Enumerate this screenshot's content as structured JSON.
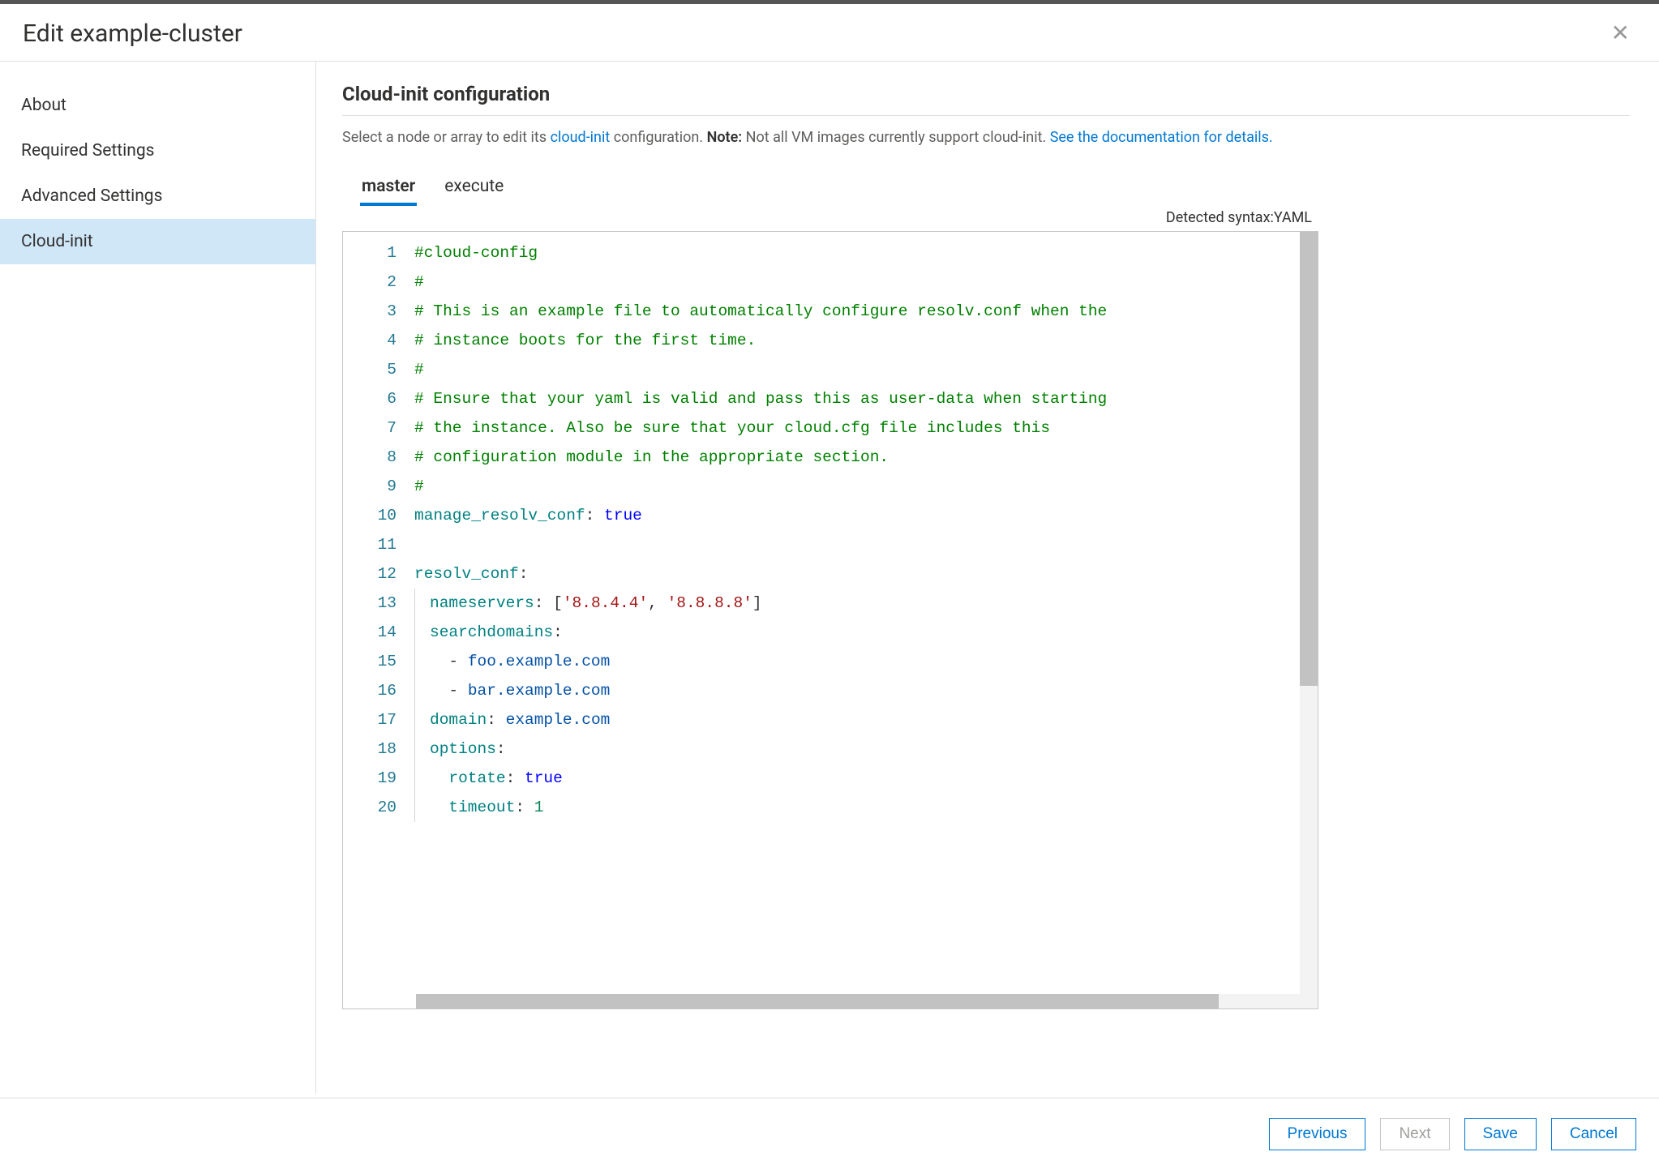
{
  "dialog": {
    "title": "Edit example-cluster"
  },
  "sidebar": {
    "items": [
      {
        "label": "About"
      },
      {
        "label": "Required Settings"
      },
      {
        "label": "Advanced Settings"
      },
      {
        "label": "Cloud-init"
      }
    ],
    "activeIndex": 3
  },
  "section": {
    "title": "Cloud-init configuration",
    "desc_pre": "Select a node or array to edit its ",
    "desc_link1": "cloud-init",
    "desc_mid1": " configuration. ",
    "desc_note_label": "Note:",
    "desc_note_text": " Not all VM images currently support cloud-init. ",
    "desc_link2": "See the documentation for details."
  },
  "tabs": {
    "items": [
      {
        "label": "master"
      },
      {
        "label": "execute"
      }
    ],
    "activeIndex": 0
  },
  "editor": {
    "syntax_label": "Detected syntax: ",
    "syntax_value": "YAML",
    "code_lines": [
      [
        {
          "cls": "tok-comment",
          "t": "#cloud-config"
        }
      ],
      [
        {
          "cls": "tok-comment",
          "t": "#"
        }
      ],
      [
        {
          "cls": "tok-comment",
          "t": "# This is an example file to automatically configure resolv.conf when the"
        }
      ],
      [
        {
          "cls": "tok-comment",
          "t": "# instance boots for the first time."
        }
      ],
      [
        {
          "cls": "tok-comment",
          "t": "#"
        }
      ],
      [
        {
          "cls": "tok-comment",
          "t": "# Ensure that your yaml is valid and pass this as user-data when starting"
        }
      ],
      [
        {
          "cls": "tok-comment",
          "t": "# the instance. Also be sure that your cloud.cfg file includes this"
        }
      ],
      [
        {
          "cls": "tok-comment",
          "t": "# configuration module in the appropriate section."
        }
      ],
      [
        {
          "cls": "tok-comment",
          "t": "#"
        }
      ],
      [
        {
          "cls": "tok-key",
          "t": "manage_resolv_conf"
        },
        {
          "cls": "tok-colon",
          "t": ": "
        },
        {
          "cls": "tok-bool",
          "t": "true"
        }
      ],
      [],
      [
        {
          "cls": "tok-key",
          "t": "resolv_conf"
        },
        {
          "cls": "tok-colon",
          "t": ":"
        }
      ],
      [
        {
          "guide": 1
        },
        {
          "cls": "tok-key",
          "t": "nameservers"
        },
        {
          "cls": "tok-colon",
          "t": ": ["
        },
        {
          "cls": "tok-str",
          "t": "'8.8.4.4'"
        },
        {
          "cls": "tok-colon",
          "t": ", "
        },
        {
          "cls": "tok-str",
          "t": "'8.8.8.8'"
        },
        {
          "cls": "tok-colon",
          "t": "]"
        }
      ],
      [
        {
          "guide": 1
        },
        {
          "cls": "tok-key",
          "t": "searchdomains"
        },
        {
          "cls": "tok-colon",
          "t": ":"
        }
      ],
      [
        {
          "guide": 1
        },
        {
          "cls": "tok-colon",
          "t": "  - "
        },
        {
          "cls": "tok-plain",
          "t": "foo.example.com"
        }
      ],
      [
        {
          "guide": 1
        },
        {
          "cls": "tok-colon",
          "t": "  - "
        },
        {
          "cls": "tok-plain",
          "t": "bar.example.com"
        }
      ],
      [
        {
          "guide": 1
        },
        {
          "cls": "tok-key",
          "t": "domain"
        },
        {
          "cls": "tok-colon",
          "t": ": "
        },
        {
          "cls": "tok-plain",
          "t": "example.com"
        }
      ],
      [
        {
          "guide": 1
        },
        {
          "cls": "tok-key",
          "t": "options"
        },
        {
          "cls": "tok-colon",
          "t": ":"
        }
      ],
      [
        {
          "guide": 1
        },
        {
          "cls": "tok-key",
          "t": "  rotate"
        },
        {
          "cls": "tok-colon",
          "t": ": "
        },
        {
          "cls": "tok-bool",
          "t": "true"
        }
      ],
      [
        {
          "guide": 1
        },
        {
          "cls": "tok-key",
          "t": "  timeout"
        },
        {
          "cls": "tok-colon",
          "t": ": "
        },
        {
          "cls": "tok-num",
          "t": "1"
        }
      ]
    ]
  },
  "footer": {
    "previous": "Previous",
    "next": "Next",
    "save": "Save",
    "cancel": "Cancel"
  }
}
